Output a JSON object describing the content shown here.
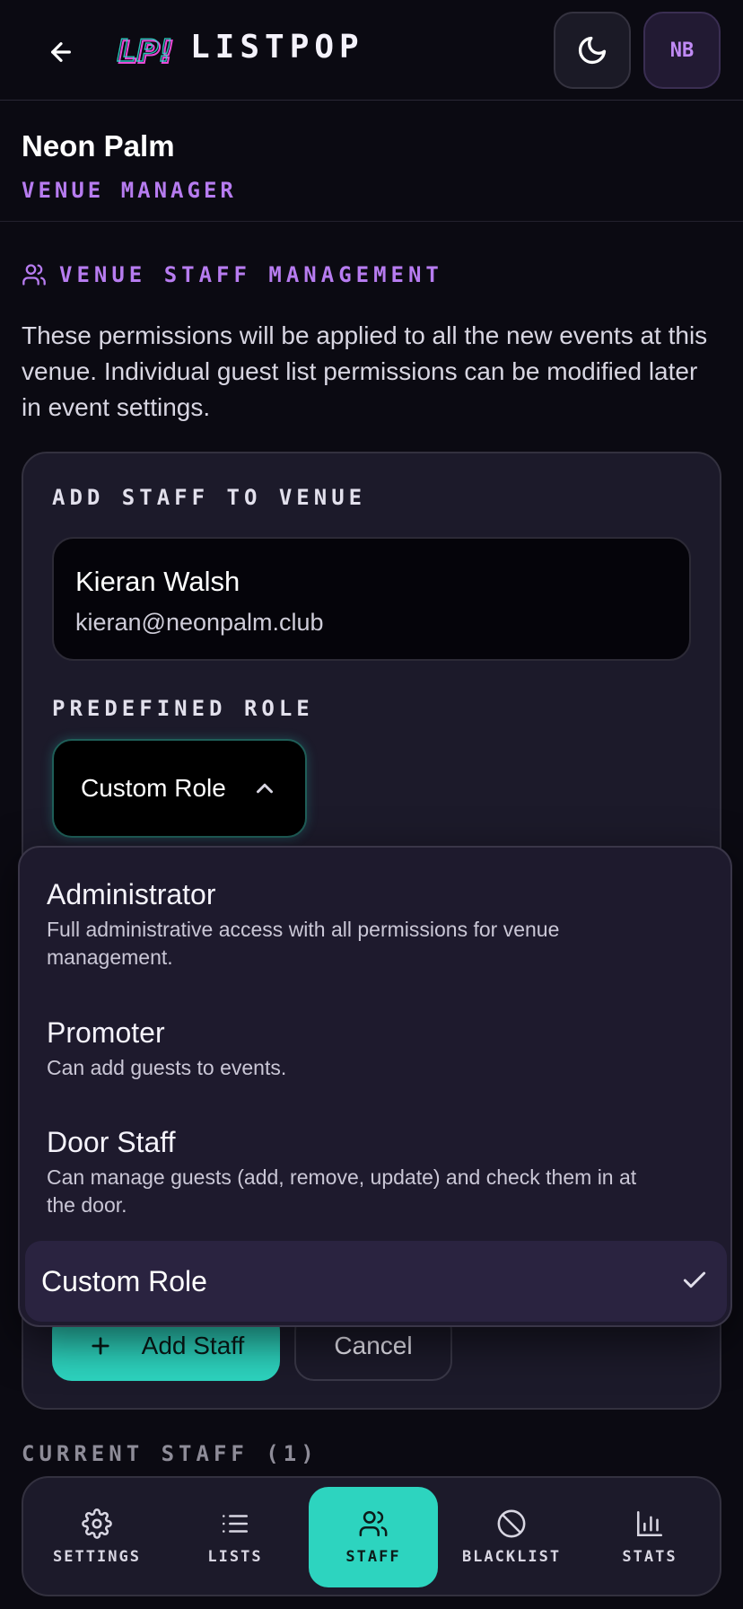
{
  "header": {
    "brand": "LISTPOP",
    "logo_text": "LP!",
    "avatar_initials": "NB"
  },
  "venue": {
    "name": "Neon Palm",
    "role": "VENUE MANAGER"
  },
  "section": {
    "title": "VENUE STAFF MANAGEMENT",
    "description": "These permissions will be applied to all the new events at this venue. Individual guest list permissions can be modified later in event settings."
  },
  "add_staff": {
    "title": "ADD STAFF TO VENUE",
    "selected_user": {
      "name": "Kieran Walsh",
      "email": "kieran@neonpalm.club"
    },
    "role_label": "PREDEFINED ROLE",
    "selected_role": "Custom Role",
    "add_button": "Add Staff",
    "cancel_button": "Cancel"
  },
  "role_options": [
    {
      "title": "Administrator",
      "description": "Full administrative access with all permissions for venue management."
    },
    {
      "title": "Promoter",
      "description": "Can add guests to events."
    },
    {
      "title": "Door Staff",
      "description": "Can manage guests (add, remove, update) and check them in at the door."
    },
    {
      "title": "Custom Role",
      "description": ""
    }
  ],
  "current_staff_label": "CURRENT STAFF (1)",
  "nav": {
    "items": [
      {
        "label": "SETTINGS",
        "icon": "gear-icon"
      },
      {
        "label": "LISTS",
        "icon": "list-icon"
      },
      {
        "label": "STAFF",
        "icon": "users-icon"
      },
      {
        "label": "BLACKLIST",
        "icon": "ban-icon"
      },
      {
        "label": "STATS",
        "icon": "bar-chart-icon"
      }
    ],
    "active": "STAFF"
  },
  "colors": {
    "accent": "#2dd4bf",
    "purple": "#b77cf0",
    "background": "#0b0a12"
  }
}
